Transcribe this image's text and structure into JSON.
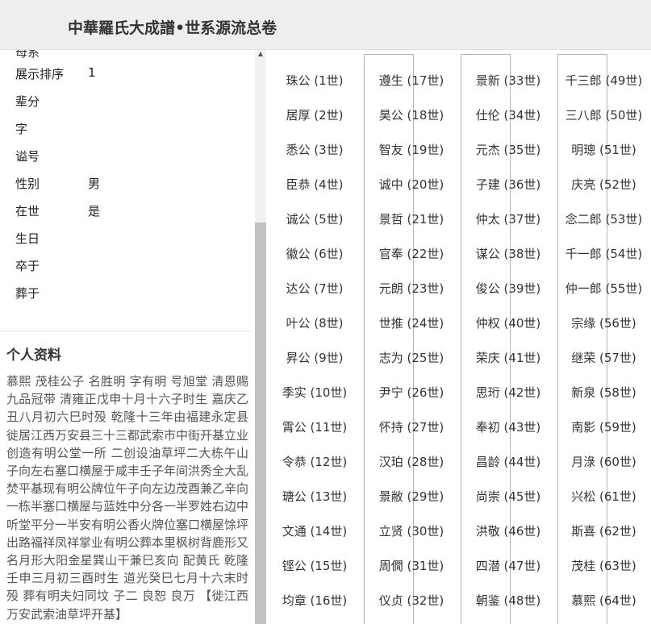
{
  "header": {
    "title": "中華羅氏大成譜•世系源流总卷"
  },
  "profile": {
    "cut_label": "母系",
    "fields": [
      {
        "label": "展示排序",
        "value": "1"
      },
      {
        "label": "辈分",
        "value": ""
      },
      {
        "label": "字",
        "value": ""
      },
      {
        "label": "谥号",
        "value": ""
      },
      {
        "label": "性别",
        "value": "男"
      },
      {
        "label": "在世",
        "value": "是"
      },
      {
        "label": "生日",
        "value": ""
      },
      {
        "label": "卒于",
        "value": ""
      },
      {
        "label": "葬于",
        "value": ""
      }
    ]
  },
  "bio": {
    "title": "个人资料",
    "text": "慕熙 茂桂公子 名胜明 字有明 号旭堂 清恩赐九品冠带 清雍正戊申十月十六子时生 嘉庆乙丑八月初六巳时殁 乾隆十三年由福建永定县徙居江西万安县三十三都武索市中街开基立业创造有明公堂一所 二创设油草坪二大栋午山子向左右塞口横屋于咸丰壬子年间洪秀全大乱焚平基现有明公牌位午子向左边茂酉兼乙辛向一栋半塞口横屋与蓝姓中分各一半罗姓右边中听堂平分一半安有明公香火牌位塞口横屋馀坪出路福祥凤祥掌业有明公葬本里枫树背鹿形又名月形大阳金星巽山干兼巳亥向 配黄氏 乾隆壬申三月初三酉时生 道光癸巳七月十六末时殁 葬有明夫妇同坟 子二 良恕 良万 【徙江西万安武索油草坪开基】"
  },
  "generations": [
    [
      "珠公 (1世)",
      "居厚 (2世)",
      "悉公 (3世)",
      "臣恭 (4世)",
      "诚公 (5世)",
      "徽公 (6世)",
      "达公 (7世)",
      "叶公 (8世)",
      "昇公 (9世)",
      "季实 (10世)",
      "霄公 (11世)",
      "令恭 (12世)",
      "瑭公 (13世)",
      "文通 (14世)",
      "铿公 (15世)",
      "均章 (16世)"
    ],
    [
      "遵生 (17世)",
      "昊公 (18世)",
      "智友 (19世)",
      "诚中 (20世)",
      "景哲 (21世)",
      "官奉 (22世)",
      "元朗 (23世)",
      "世推 (24世)",
      "志为 (25世)",
      "尹宁 (26世)",
      "怀持 (27世)",
      "汉珀 (28世)",
      "景敝 (29世)",
      "立贤 (30世)",
      "周僩 (31世)",
      "仪贞 (32世)"
    ],
    [
      "景新 (33世)",
      "仕伦 (34世)",
      "元杰 (35世)",
      "子建 (36世)",
      "仲太 (37世)",
      "谋公 (38世)",
      "俊公 (39世)",
      "仲权 (40世)",
      "荣庆 (41世)",
      "思珩 (42世)",
      "奉初 (43世)",
      "昌龄 (44世)",
      "尚崇 (45世)",
      "洪敬 (46世)",
      "四潜 (47世)",
      "朝鉴 (48世)"
    ],
    [
      "千三郎 (49世)",
      "三八郎 (50世)",
      "明璁 (51世)",
      "庆亮 (52世)",
      "念二郎 (53世)",
      "千一郎 (54世)",
      "仲一郎 (55世)",
      "宗缘 (56世)",
      "继荣 (57世)",
      "新泉 (58世)",
      "南影 (59世)",
      "月淥 (60世)",
      "兴松 (61世)",
      "斯喜 (62世)",
      "茂桂 (63世)",
      "慕熙 (64世)"
    ]
  ]
}
